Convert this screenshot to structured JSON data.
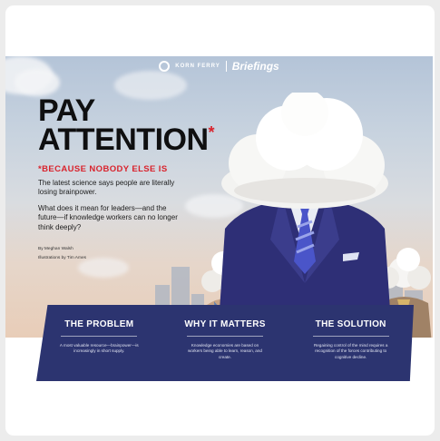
{
  "header": {
    "brand": "KORN FERRY",
    "publication": "Briefings"
  },
  "hero": {
    "headline_line1": "PAY",
    "headline_line2": "ATTENTION",
    "asterisk": "*",
    "subhead": "*BECAUSE NOBODY ELSE IS",
    "intro": "The latest science says people are literally losing brainpower.",
    "question": "What does it mean for leaders—and the future—if knowledge workers can no longer think deeply?",
    "byline": "By Meghan Walsh",
    "illustrations": "Illustrations by Tim Ames"
  },
  "panels": [
    {
      "title": "THE PROBLEM",
      "text": "A most valuable resource—brainpower—is increasingly in short supply."
    },
    {
      "title": "WHY IT MATTERS",
      "text": "Knowledge economies are based on workers being able to learn, reason, and create."
    },
    {
      "title": "THE SOLUTION",
      "text": "Regaining control of the mind requires a recognition of the forces contributing to cognitive decline."
    }
  ],
  "colors": {
    "panel_bg": "#2c3470",
    "accent_red": "#d9232d",
    "suit_navy": "#2e2f76",
    "tie_blue": "#4a55c9"
  },
  "icons": {
    "logo": "korn-ferry-logo-icon"
  }
}
